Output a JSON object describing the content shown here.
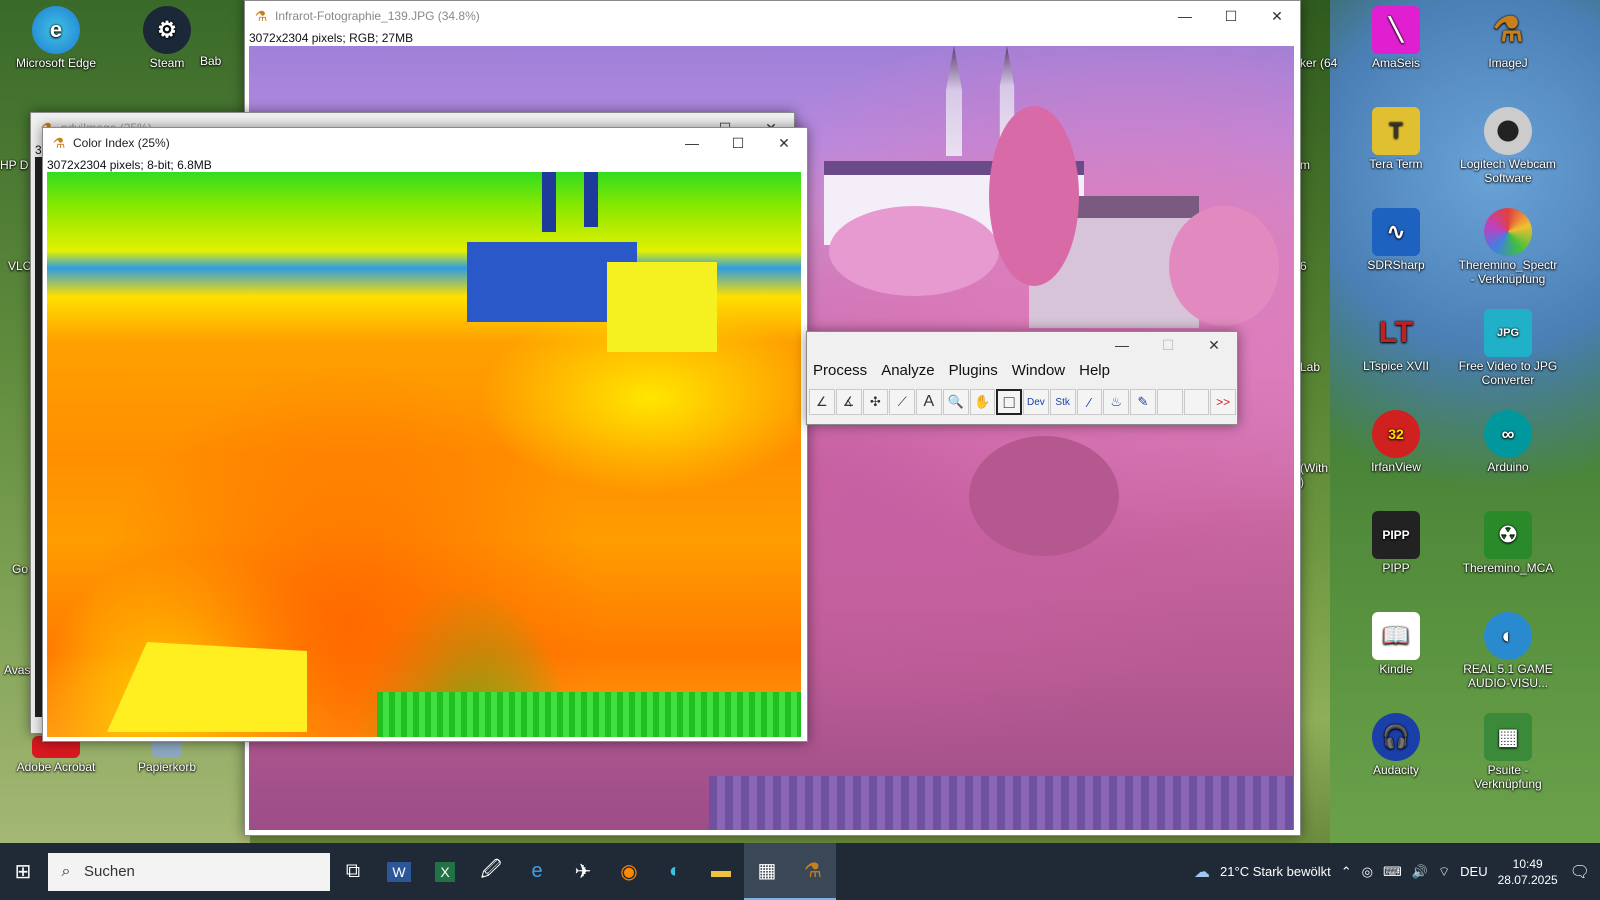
{
  "desktop": {
    "left_icons": [
      {
        "label": "Microsoft Edge",
        "icon": "edge-icon",
        "color": "#1f7bd8"
      },
      {
        "label": "Steam",
        "icon": "steam-icon",
        "color": "#1b2838"
      },
      {
        "label": "Adobe Acrobat",
        "icon": "acrobat-icon",
        "color": "#d71920"
      },
      {
        "label": "Papierkorb",
        "icon": "recycle-bin-icon",
        "color": "#8ca8c0"
      }
    ],
    "partial_left": [
      "Bab",
      "HP D",
      "VLC",
      "Go",
      "Avas"
    ],
    "right_icons": [
      {
        "label": "AmaSeis",
        "icon": "amaseis-icon",
        "color": "#e020d0"
      },
      {
        "label": "ImageJ",
        "icon": "imagej-icon",
        "color": "#c8801c"
      },
      {
        "label": "Tera Term",
        "icon": "teraterm-icon",
        "color": "#e0c030"
      },
      {
        "label": "Logitech Webcam Software",
        "icon": "webcam-icon",
        "color": "#888888"
      },
      {
        "label": "SDRSharp",
        "icon": "sdrsharp-icon",
        "color": "#1e62c0"
      },
      {
        "label": "Theremino_Spectr - Verknüpfung",
        "icon": "theremino-spectr-icon",
        "color": "#e04040"
      },
      {
        "label": "LTspice XVII",
        "icon": "ltspice-icon",
        "color": "#c02020"
      },
      {
        "label": "Free Video to JPG Converter",
        "icon": "jpg-converter-icon",
        "color": "#20b0c8"
      },
      {
        "label": "IrfanView",
        "icon": "irfanview-icon",
        "color": "#d02020"
      },
      {
        "label": "Arduino",
        "icon": "arduino-icon",
        "color": "#00979d"
      },
      {
        "label": "PIPP",
        "icon": "pipp-icon",
        "color": "#222222"
      },
      {
        "label": "Theremino_MCA",
        "icon": "theremino-mca-icon",
        "color": "#2a8a2a"
      },
      {
        "label": "Kindle",
        "icon": "kindle-icon",
        "color": "#ffffff"
      },
      {
        "label": "REAL 5.1 GAME AUDIO-VISU...",
        "icon": "real-audio-icon",
        "color": "#2a8ad0"
      },
      {
        "label": "Audacity",
        "icon": "audacity-icon",
        "color": "#1a3fa8"
      },
      {
        "label": "Psuite - Verknüpfung",
        "icon": "psuite-icon",
        "color": "#3a8a3a"
      }
    ],
    "partial_right": [
      "ker (64",
      "m",
      "6",
      "Lab",
      "(With",
      ")"
    ]
  },
  "window_infrared": {
    "title": "Infrarot-Fotographie_139.JPG (34.8%)",
    "info": "3072x2304 pixels; RGB; 27MB"
  },
  "window_ndvi": {
    "title": "ndviImage (25%)",
    "info": "3"
  },
  "window_color_index": {
    "title": "Color Index (25%)",
    "info": "3072x2304 pixels; 8-bit; 6.8MB"
  },
  "imagej_toolbar": {
    "menus": [
      "Process",
      "Analyze",
      "Plugins",
      "Window",
      "Help"
    ],
    "tools": [
      {
        "name": "polyline-tool",
        "glyph": "∠"
      },
      {
        "name": "angle-tool",
        "glyph": "∡"
      },
      {
        "name": "point-tool",
        "glyph": "✣"
      },
      {
        "name": "wand-tool",
        "glyph": "⟋"
      },
      {
        "name": "text-tool",
        "glyph": "A"
      },
      {
        "name": "magnifier-tool",
        "glyph": "🔍"
      },
      {
        "name": "hand-tool",
        "glyph": "✋"
      },
      {
        "name": "color-picker-tool",
        "glyph": "□"
      },
      {
        "name": "dev-tool",
        "glyph": "Dev"
      },
      {
        "name": "stk-tool",
        "glyph": "Stk"
      },
      {
        "name": "brush-tool",
        "glyph": "∕"
      },
      {
        "name": "flood-fill-tool",
        "glyph": "♨"
      },
      {
        "name": "pencil-tool",
        "glyph": "✎"
      },
      {
        "name": "empty-slot-1",
        "glyph": ""
      },
      {
        "name": "empty-slot-2",
        "glyph": ""
      },
      {
        "name": "more-tools",
        "glyph": ">>"
      }
    ]
  },
  "taskbar": {
    "search_placeholder": "Suchen",
    "apps": [
      "task-view-icon",
      "word-icon",
      "excel-icon",
      "app-icon",
      "ie-icon",
      "app2-icon",
      "firefox-icon",
      "edge-icon",
      "explorer-icon",
      "imagej-app-icon",
      "imagej2-icon"
    ],
    "weather": "21°C  Stark bewölkt",
    "language": "DEU",
    "time": "10:49",
    "date": "28.07.2025"
  }
}
